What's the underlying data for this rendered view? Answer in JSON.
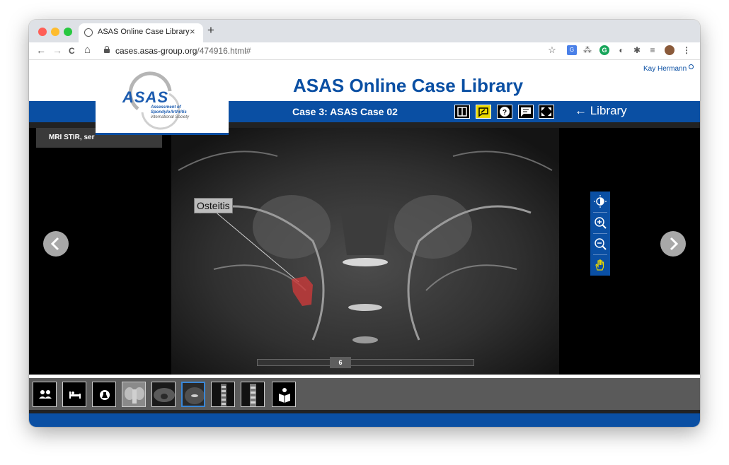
{
  "browser": {
    "tab_title": "ASAS Online Case Library",
    "tab_close": "×",
    "new_tab": "+",
    "url_host": "cases.asas-group.org",
    "url_path": "/474916.html#",
    "back_icon": "←",
    "forward_icon": "→",
    "reload_icon": "C",
    "home_icon": "⌂"
  },
  "site": {
    "title": "ASAS Online Case Library",
    "user_name": "Kay Hermann",
    "logo_text": "ASAS",
    "logo_sub1": "Assessment of",
    "logo_sub2": "SpondyloArthritis",
    "logo_sub3": "international Society",
    "case_title": "Case 3: ASAS Case 02",
    "library_link": "← Library",
    "accent_color": "#0a4fa3"
  },
  "viewer": {
    "series_label": "MRI STIR, ser",
    "annotation": "Osteitis",
    "slice_number": "6"
  },
  "thumbnails": [
    {
      "kind": "patients-icon"
    },
    {
      "kind": "clinical-icon"
    },
    {
      "kind": "lab-icon"
    },
    {
      "kind": "xray-pelvis"
    },
    {
      "kind": "mri-axial"
    },
    {
      "kind": "mri-coronal",
      "active": true
    },
    {
      "kind": "mri-spine"
    },
    {
      "kind": "mri-spine-2"
    },
    {
      "kind": "book-icon"
    }
  ]
}
